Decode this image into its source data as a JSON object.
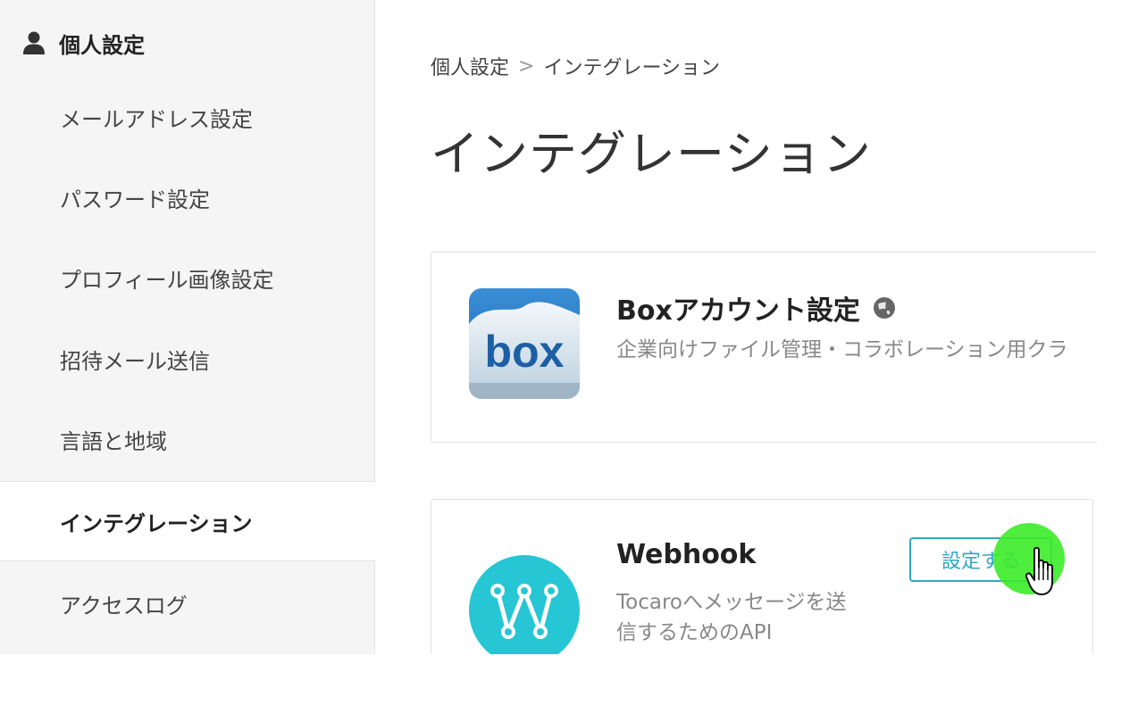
{
  "sidebar": {
    "header_label": "個人設定",
    "items": [
      {
        "label": "メールアドレス設定"
      },
      {
        "label": "パスワード設定"
      },
      {
        "label": "プロフィール画像設定"
      },
      {
        "label": "招待メール送信"
      },
      {
        "label": "言語と地域"
      },
      {
        "label": "インテグレーション",
        "active": true
      },
      {
        "label": "アクセスログ"
      }
    ]
  },
  "breadcrumb": {
    "parent": "個人設定",
    "separator": ">",
    "current": "インテグレーション"
  },
  "page_title": "インテグレーション",
  "integrations": [
    {
      "title": "Boxアカウント設定",
      "description": "企業向けファイル管理・コラボレーション用クラ",
      "logo_text": "box",
      "title_icon": "globe-icon"
    },
    {
      "title": "Webhook",
      "description": "Tocaroへメッセージを送信するためのAPI",
      "button_label": "設定する",
      "logo_icon": "webhook-icon"
    }
  ],
  "colors": {
    "accent": "#2fa7c6",
    "webhook_teal": "#26c6d4",
    "cursor_highlight": "#3ceb28"
  }
}
